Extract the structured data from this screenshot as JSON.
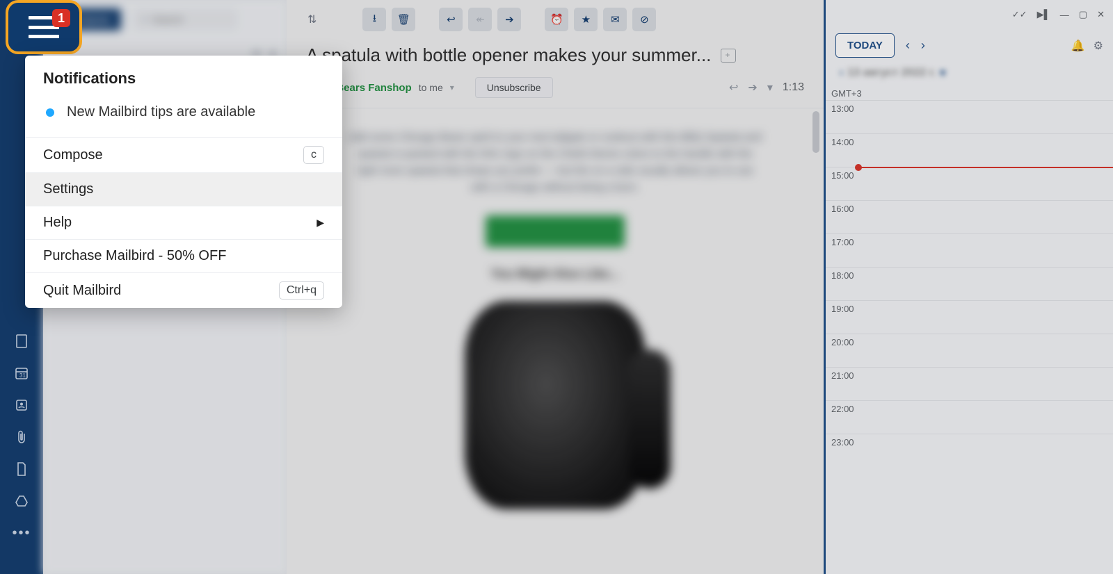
{
  "hamburger": {
    "badge": "1"
  },
  "rail": {
    "icons": [
      "document-icon",
      "calendar-icon",
      "contacts-icon",
      "attachments-icon",
      "page-icon",
      "drive-icon"
    ],
    "more": "•••"
  },
  "compose": {
    "label": "Compose"
  },
  "search": {
    "placeholder": "Search"
  },
  "subject": "A spatula with bottle opener makes your summer...",
  "sender": {
    "name": "icago Bears Fanshop",
    "to": "to me"
  },
  "unsubscribe": "Unsubscribe",
  "time": "1:13",
  "body": {
    "para": "Add some Chicago Bears spirit to your next tailgate or cookout with this BBQ Spatula and spatula is packed with the NHL logo on the Chiefs theme colors to the handle with the right more spatula that shops you prefer — but the on a side usually allows you to use with a Chicago without being a burn.",
    "cta": "GET YOUR GRILL",
    "section": "You Might Also Like..."
  },
  "calendar": {
    "today_label": "TODAY",
    "date": "13 август 2022 г.",
    "timezone": "GMT+3",
    "hours": [
      "13:00",
      "14:00",
      "15:00",
      "16:00",
      "17:00",
      "18:00",
      "19:00",
      "20:00",
      "21:00",
      "22:00",
      "23:00"
    ],
    "now_row_index": 2
  },
  "menu": {
    "title": "Notifications",
    "notification": "New Mailbird tips are available",
    "items": [
      {
        "label": "Compose",
        "shortcut": "c"
      },
      {
        "label": "Settings"
      },
      {
        "label": "Help",
        "submenu": true
      },
      {
        "label": "Purchase Mailbird - 50% OFF"
      },
      {
        "label": "Quit Mailbird",
        "shortcut": "Ctrl+q"
      }
    ]
  }
}
